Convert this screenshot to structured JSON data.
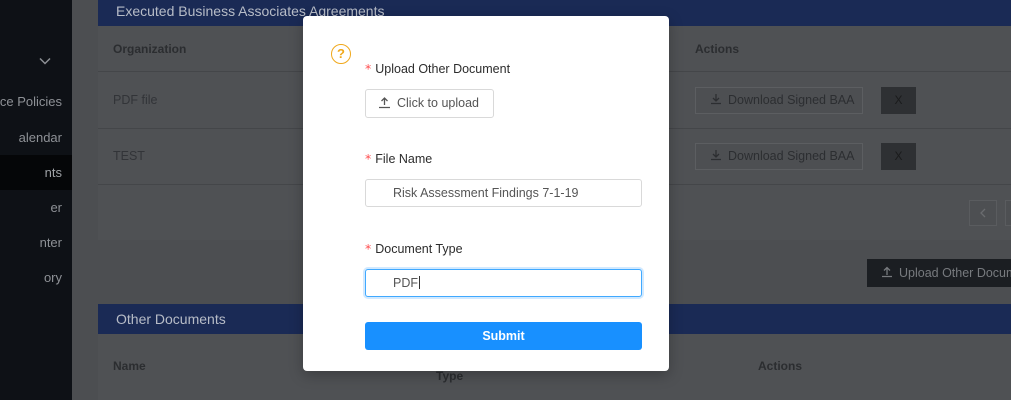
{
  "sidebar": {
    "items": [
      {
        "label": "ace Policies"
      },
      {
        "label": "alendar"
      },
      {
        "label": "nts",
        "active": true
      },
      {
        "label": "er"
      },
      {
        "label": "nter"
      },
      {
        "label": "ory"
      }
    ]
  },
  "baa_section": {
    "title": "Executed Business Associates Agreements",
    "columns": {
      "organization": "Organization",
      "actions": "Actions"
    },
    "rows": [
      {
        "organization": "PDF file",
        "download_label": "Download Signed BAA",
        "remove_label": "X"
      },
      {
        "organization": "TEST",
        "download_label": "Download Signed BAA",
        "remove_label": "X"
      }
    ],
    "pagination_prev": "‹"
  },
  "upload_other_button": "Upload Other Docum",
  "other_section": {
    "title": "Other Documents",
    "columns": {
      "name": "Name",
      "type": "Type",
      "actions": "Actions"
    }
  },
  "modal": {
    "help_icon": "?",
    "upload": {
      "label": "Upload Other Document",
      "button_label": "Click to upload"
    },
    "file_name": {
      "label": "File Name",
      "value": "Risk Assessment Findings 7-1-19"
    },
    "document_type": {
      "label": "Document Type",
      "value": "PDF"
    },
    "submit_label": "Submit",
    "required_mark": "*"
  },
  "colors": {
    "primary": "#1890ff",
    "warning": "#f0a81c",
    "required": "#ff4d4f",
    "header_bar": "#1a2a55"
  }
}
